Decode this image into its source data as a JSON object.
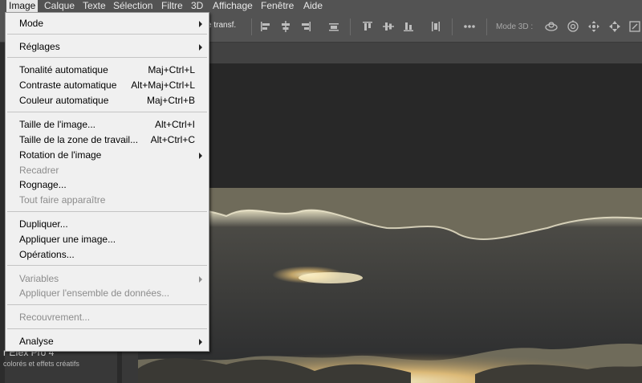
{
  "menubar": {
    "items": [
      {
        "label": "Image",
        "active": true
      },
      {
        "label": "Calque"
      },
      {
        "label": "Texte"
      },
      {
        "label": "Sélection"
      },
      {
        "label": "Filtre"
      },
      {
        "label": "3D"
      },
      {
        "label": "Affichage"
      },
      {
        "label": "Fenêtre"
      },
      {
        "label": "Aide"
      }
    ]
  },
  "options_bar": {
    "transform_label": "e transf.",
    "mode3d_label": "Mode 3D :",
    "more_icon": "more-horizontal-icon"
  },
  "image_menu": {
    "items": [
      {
        "label": "Mode",
        "submenu": true
      },
      {
        "label": "Réglages",
        "submenu": true
      },
      {
        "label": "Tonalité automatique",
        "shortcut": "Maj+Ctrl+L"
      },
      {
        "label": "Contraste automatique",
        "shortcut": "Alt+Maj+Ctrl+L"
      },
      {
        "label": "Couleur automatique",
        "shortcut": "Maj+Ctrl+B"
      },
      {
        "label": "Taille de l'image...",
        "shortcut": "Alt+Ctrl+I"
      },
      {
        "label": "Taille de la zone de travail...",
        "shortcut": "Alt+Ctrl+C"
      },
      {
        "label": "Rotation de l'image",
        "submenu": true
      },
      {
        "label": "Recadrer",
        "disabled": true
      },
      {
        "label": "Rognage..."
      },
      {
        "label": "Tout faire apparaître",
        "disabled": true
      },
      {
        "label": "Dupliquer..."
      },
      {
        "label": "Appliquer une image..."
      },
      {
        "label": "Opérations..."
      },
      {
        "label": "Variables",
        "submenu": true,
        "disabled": true
      },
      {
        "label": "Appliquer l'ensemble de données...",
        "disabled": true
      },
      {
        "label": "Recouvrement...",
        "disabled": true
      },
      {
        "label": "Analyse",
        "submenu": true
      }
    ]
  },
  "left_panel": {
    "plugin_title": "r Efex Pro 4",
    "plugin_subtitle": "colorés et effets créatifs"
  },
  "colors": {
    "menubar_bg": "#535353",
    "menu_bg": "#f0f0f0",
    "workspace_bg": "#282828",
    "accent_orange": "#e0a040"
  }
}
